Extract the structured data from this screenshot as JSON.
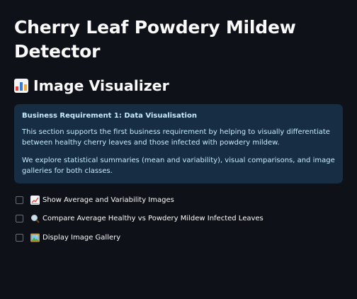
{
  "page": {
    "title": "Cherry Leaf Powdery Mildew Detector",
    "subheader": {
      "icon": "bar-chart-emoji",
      "text": "Image Visualizer"
    }
  },
  "info_box": {
    "heading": "Business Requirement 1: Data Visualisation",
    "paragraph_1": "This section supports the first business requirement by helping to visually differentiate between healthy cherry leaves and those infected with powdery mildew.",
    "paragraph_2": "We explore statistical summaries (mean and variability), visual comparisons, and image galleries for both classes."
  },
  "checkboxes": [
    {
      "icon": "chart-increasing-emoji",
      "label": "Show Average and Variability Images",
      "checked": false
    },
    {
      "icon": "magnifying-glass-emoji",
      "label": "Compare Average Healthy vs Powdery Mildew Infected Leaves",
      "checked": false
    },
    {
      "icon": "framed-picture-emoji",
      "label": "Display Image Gallery",
      "checked": false
    }
  ],
  "colors": {
    "background": "#0e1117",
    "text": "#fafafa",
    "info_bg": "#172d43",
    "info_text": "#c7ebff"
  }
}
